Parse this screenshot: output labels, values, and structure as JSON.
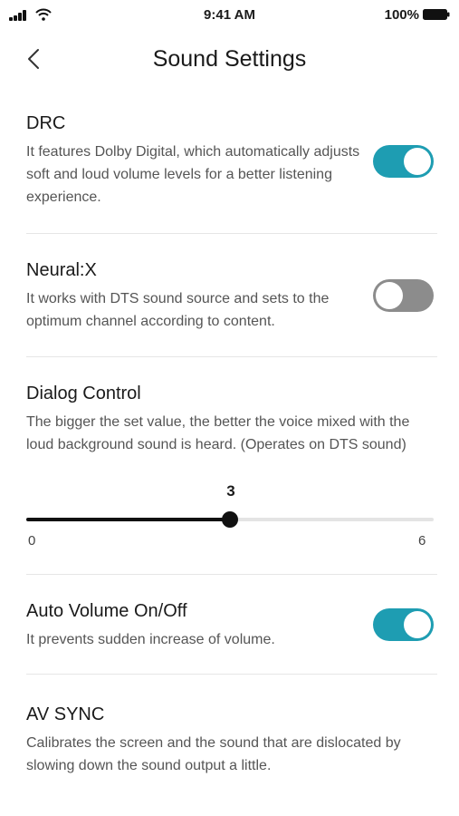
{
  "status_bar": {
    "time": "9:41 AM",
    "battery_percent": "100%"
  },
  "header": {
    "title": "Sound Settings",
    "back_icon": "chevron-left-icon"
  },
  "settings": {
    "drc": {
      "title": "DRC",
      "description": "It features Dolby Digital, which automatically adjusts soft and loud volume levels for a better listening experience.",
      "enabled": true
    },
    "neural_x": {
      "title": "Neural:X",
      "description": "It works with DTS sound source and sets to the optimum channel according to content.",
      "enabled": false
    },
    "dialog_control": {
      "title": "Dialog Control",
      "description": "The bigger the set value, the better the voice mixed with the loud background sound is heard. (Operates on DTS sound)",
      "value": 3,
      "min": 0,
      "max": 6
    },
    "auto_volume": {
      "title": "Auto Volume On/Off",
      "description": "It prevents sudden increase of volume.",
      "enabled": true
    },
    "av_sync": {
      "title": "AV SYNC",
      "description": "Calibrates the screen and the sound that are dislocated by slowing down the sound output a little."
    }
  },
  "colors": {
    "accent": "#1e9db2",
    "toggle_off": "#8c8c8c"
  }
}
